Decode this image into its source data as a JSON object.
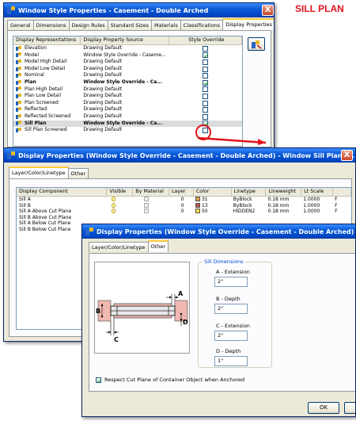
{
  "caption": "SILL PLAN",
  "win1": {
    "title": "Window Style Properties - Casement - Double Arched",
    "close": "X",
    "tabs": [
      "General",
      "Dimensions",
      "Design Rules",
      "Standard Sizes",
      "Materials",
      "Classifications",
      "Display Properties"
    ],
    "columns": [
      "Display Representations",
      "Display Property Source",
      "Style Override"
    ],
    "rows": [
      {
        "name": "Elevation",
        "source": "Drawing Default",
        "checked": false,
        "bold": false
      },
      {
        "name": "Model",
        "source": "Window Style Override - Caseme...",
        "checked": true,
        "bold": false
      },
      {
        "name": "Model High Detail",
        "source": "Drawing Default",
        "checked": false,
        "bold": false
      },
      {
        "name": "Model Low Detail",
        "source": "Drawing Default",
        "checked": false,
        "bold": false
      },
      {
        "name": "Nominal",
        "source": "Drawing Default",
        "checked": false,
        "bold": false
      },
      {
        "name": "Plan",
        "source": "Window Style Override - Ca...",
        "checked": true,
        "bold": true
      },
      {
        "name": "Plan High Detail",
        "source": "Drawing Default",
        "checked": false,
        "bold": false
      },
      {
        "name": "Plan Low Detail",
        "source": "Drawing Default",
        "checked": false,
        "bold": false
      },
      {
        "name": "Plan Screened",
        "source": "Drawing Default",
        "checked": false,
        "bold": false
      },
      {
        "name": "Reflected",
        "source": "Drawing Default",
        "checked": false,
        "bold": false
      },
      {
        "name": "Reflected Screened",
        "source": "Drawing Default",
        "checked": false,
        "bold": false
      },
      {
        "name": "Sill Plan",
        "source": "Window Style Override - Ca...",
        "checked": true,
        "bold": true,
        "selected": true
      },
      {
        "name": "Sill Plan Screened",
        "source": "Drawing Default",
        "checked": false,
        "bold": false
      }
    ]
  },
  "win2": {
    "title": "Display Properties (Window Style Override - Casement - Double Arched) - Window Sill Plan D...",
    "close": "X",
    "tabs": [
      "Layer/Color/Linetype",
      "Other"
    ],
    "columns": [
      "Display Component",
      "Visible",
      "By Material",
      "Layer",
      "Color",
      "Linetype",
      "Lineweight",
      "Lt Scale",
      ""
    ],
    "rows": [
      {
        "component": "Sill A",
        "layer": "0",
        "color": "31",
        "swatch": "#d9a44e",
        "linetype": "ByBlock",
        "lineweight": "0.18 mm",
        "ltscale": "1.0000",
        "extra": "F"
      },
      {
        "component": "Sill B",
        "layer": "0",
        "color": "13",
        "swatch": "#b5584a",
        "linetype": "ByBlock",
        "lineweight": "0.18 mm",
        "ltscale": "1.0000",
        "extra": "F"
      },
      {
        "component": "Sill A Above Cut Plane",
        "layer": "0",
        "color": "50",
        "swatch": "#f5e04a",
        "linetype": "HIDDEN2",
        "lineweight": "0.18 mm",
        "ltscale": "1.0000",
        "extra": "F"
      },
      {
        "component": "Sill B Above Cut Plane",
        "layer": "",
        "color": "",
        "swatch": "",
        "linetype": "",
        "lineweight": "",
        "ltscale": "",
        "extra": ""
      },
      {
        "component": "Sill A Below Cut Plane",
        "layer": "",
        "color": "",
        "swatch": "",
        "linetype": "",
        "lineweight": "",
        "ltscale": "",
        "extra": ""
      },
      {
        "component": "Sill B Below Cut Plane",
        "layer": "",
        "color": "",
        "swatch": "",
        "linetype": "",
        "lineweight": "",
        "ltscale": "",
        "extra": ""
      }
    ]
  },
  "win3": {
    "title": "Display Properties (Window Style Override - Casement - Double Arched) - Wi",
    "tabs": [
      "Layer/Color/Linetype",
      "Other"
    ],
    "group_title": "Sill Dimensions",
    "fields": [
      {
        "label": "A - Extension",
        "value": "2\""
      },
      {
        "label": "B - Depth",
        "value": "2\""
      },
      {
        "label": "C - Extension",
        "value": "2\""
      },
      {
        "label": "D - Depth",
        "value": "1\""
      }
    ],
    "diagram_labels": [
      "A",
      "B",
      "C",
      "D"
    ],
    "checkbox_label": "Respect Cut Plane of Container Object when Anchored",
    "ok": "OK"
  },
  "colors": {
    "callout_red": "#e0141c",
    "title_blue": "#0a5ad6",
    "sill_pink": "#f0b8b0"
  }
}
